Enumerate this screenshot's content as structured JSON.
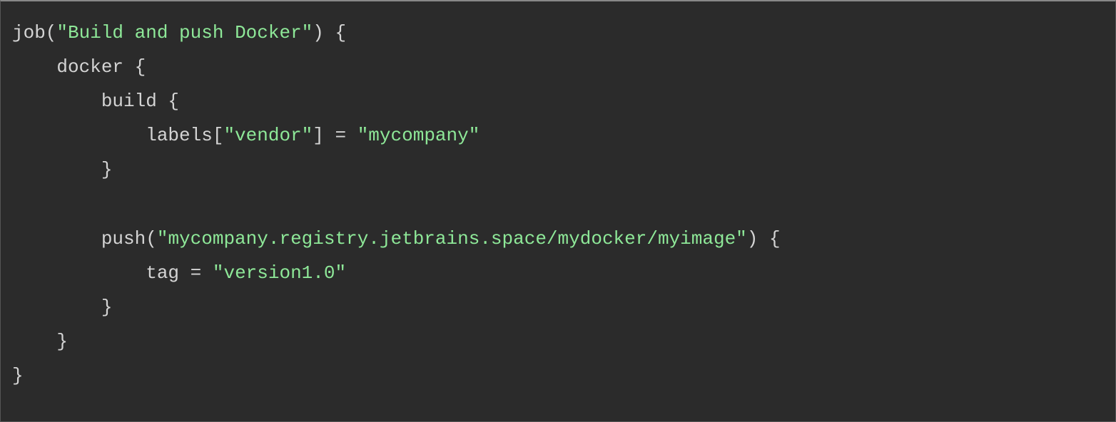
{
  "code": {
    "line1": {
      "t1": "job(",
      "t2": "\"Build and push Docker\"",
      "t3": ") {"
    },
    "line2": {
      "t1": "    docker {"
    },
    "line3": {
      "t1": "        build {"
    },
    "line4": {
      "t1": "            labels[",
      "t2": "\"vendor\"",
      "t3": "] = ",
      "t4": "\"mycompany\""
    },
    "line5": {
      "t1": "        }"
    },
    "line6": {
      "t1": ""
    },
    "line7": {
      "t1": "        push(",
      "t2": "\"mycompany.registry.jetbrains.space/mydocker/myimage\"",
      "t3": ") {"
    },
    "line8": {
      "t1": "            tag = ",
      "t2": "\"version1.0\""
    },
    "line9": {
      "t1": "        }"
    },
    "line10": {
      "t1": "    }"
    },
    "line11": {
      "t1": "}"
    }
  }
}
